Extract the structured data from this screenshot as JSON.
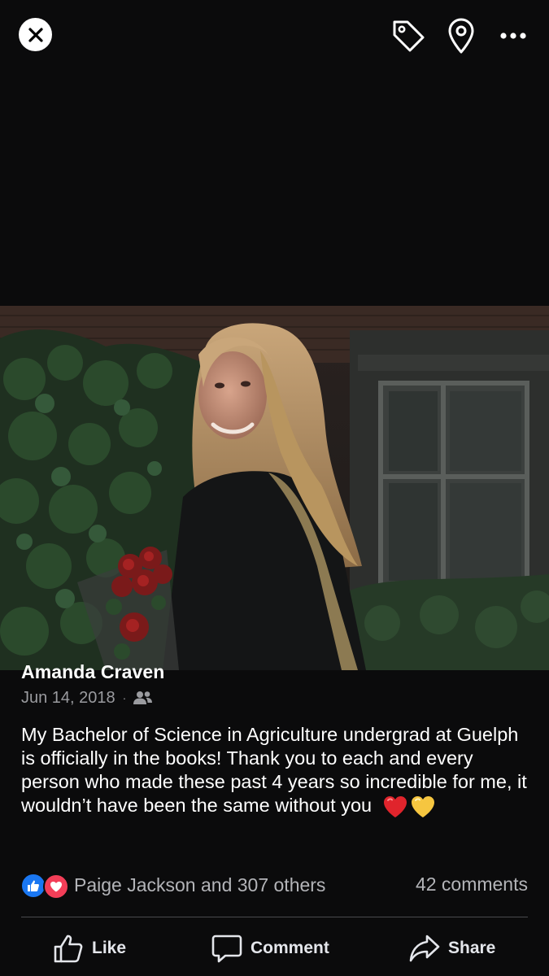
{
  "post": {
    "author": "Amanda Craven",
    "date": "Jun 14, 2018",
    "separator": "·",
    "audience_icon": "friends-icon",
    "text": "My Bachelor of Science in Agriculture undergrad at Guelph is officially in the books! Thank you to each and every person who made these past 4 years so incredible for me, it wouldn’t have been the same without you",
    "emojis": [
      "red-heart",
      "yellow-heart"
    ],
    "photo_subject": "graduate in black gown holding red roses in front of brick building with ivy"
  },
  "reactions": {
    "types": [
      "like",
      "love"
    ],
    "summary": "Paige Jackson and 307 others",
    "comments": "42 comments"
  },
  "actions": {
    "like_label": "Like",
    "comment_label": "Comment",
    "share_label": "Share"
  },
  "icons": {
    "close": "close-icon",
    "tag": "tag-icon",
    "location": "location-pin-icon",
    "more": "more-dots-icon"
  },
  "colors": {
    "background": "#0b0b0c",
    "like_blue": "#1a77f2",
    "love_red": "#f33e58",
    "secondary_text": "#9a9b9f"
  }
}
